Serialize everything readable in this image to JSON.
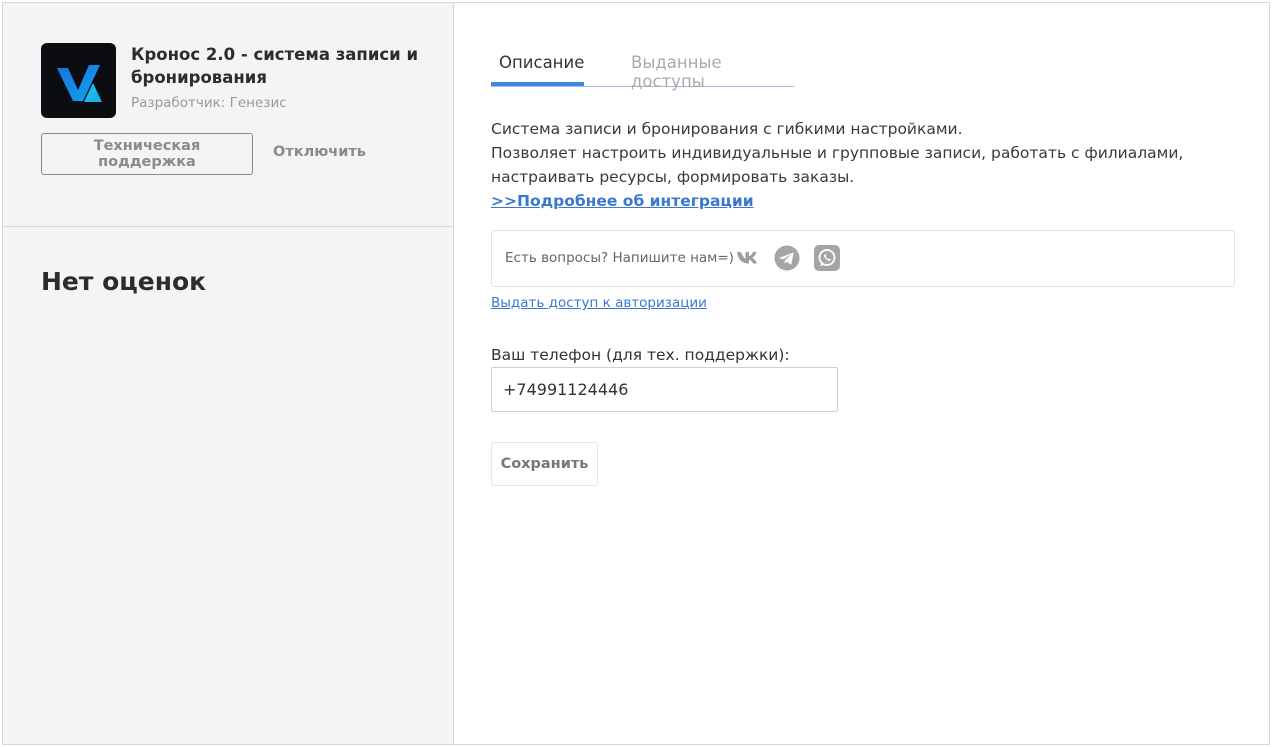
{
  "app": {
    "title": "Кронос 2.0 - система записи и бронирования",
    "developer": "Разработчик: Генезис",
    "logo_icon": "kronos-logo-icon",
    "support_button": "Техническая поддержка",
    "disable_button": "Отключить",
    "ratings": "Нет оценок"
  },
  "tabs": [
    {
      "label": "Описание",
      "active": true
    },
    {
      "label": "Выданные доступы",
      "active": false
    }
  ],
  "description": {
    "line1": "Система записи и бронирования с гибкими настройками.",
    "line2": "Позволяет настроить индивидуальные и групповые записи, работать с филиалами, настраивать ресурсы, формировать заказы.",
    "more_link": ">>Подробнее об интеграции"
  },
  "contact": {
    "text": "Есть вопросы? Напишите нам=)",
    "icons": [
      "vk-icon",
      "telegram-icon",
      "whatsapp-icon"
    ]
  },
  "auth_link": "Выдать доступ к авторизации",
  "phone": {
    "label": "Ваш телефон (для тех. поддержки):",
    "value": "+74991124446"
  },
  "save_button": "Сохранить",
  "colors": {
    "accent": "#3f86dd",
    "link": "#3a78cf",
    "sidebar_bg": "#f4f4f4"
  }
}
